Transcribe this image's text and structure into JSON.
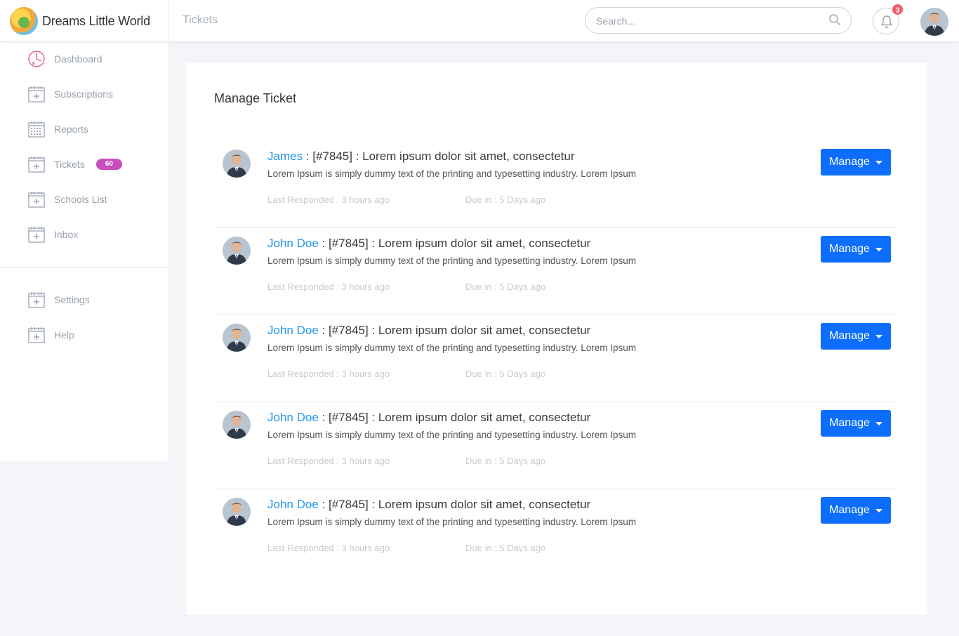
{
  "app": {
    "brand_name": "Dreams Little World"
  },
  "header": {
    "breadcrumb": "Tickets",
    "search_placeholder": "Search...",
    "notification_count": "3"
  },
  "sidebar": {
    "items": [
      {
        "label": "Dashboard",
        "icon": "dashboard-icon"
      },
      {
        "label": "Subscriptions",
        "icon": "calendar-plus-icon"
      },
      {
        "label": "Reports",
        "icon": "calendar-grid-icon"
      },
      {
        "label": "Tickets",
        "icon": "calendar-plus-icon",
        "badge": "60"
      },
      {
        "label": "Schools List",
        "icon": "calendar-plus-icon"
      },
      {
        "label": "Inbox",
        "icon": "calendar-plus-icon"
      }
    ],
    "bottom_items": [
      {
        "label": "Settings",
        "icon": "calendar-plus-icon"
      },
      {
        "label": "Help",
        "icon": "calendar-plus-icon"
      }
    ]
  },
  "main": {
    "title": "Manage Ticket",
    "tickets": [
      {
        "name": "James",
        "separator": " : ",
        "subject": "[#7845] : Lorem ipsum dolor sit amet, consectetur",
        "description": "Lorem Ipsum is simply dummy text of the printing and typesetting industry. Lorem Ipsum",
        "last_responded": "Last Responded : 3 hours ago",
        "due": "Due in : 5 Days ago",
        "button": "Manage"
      },
      {
        "name": "John Doe",
        "separator": " : ",
        "subject": "[#7845] : Lorem ipsum dolor sit amet, consectetur",
        "description": "Lorem Ipsum is simply dummy text of the printing and typesetting industry. Lorem Ipsum",
        "last_responded": "Last Responded : 3 hours ago",
        "due": "Due in : 5 Days ago",
        "button": "Manage"
      },
      {
        "name": "John Doe",
        "separator": " : ",
        "subject": "[#7845] : Lorem ipsum dolor sit amet, consectetur",
        "description": "Lorem Ipsum is simply dummy text of the printing and typesetting industry. Lorem Ipsum",
        "last_responded": "Last Responded : 3 hours ago",
        "due": "Due in : 5 Days ago",
        "button": "Manage"
      },
      {
        "name": "John Doe",
        "separator": " : ",
        "subject": "[#7845] : Lorem ipsum dolor sit amet, consectetur",
        "description": "Lorem Ipsum is simply dummy text of the printing and typesetting industry. Lorem Ipsum",
        "last_responded": "Last Responded : 3 hours ago",
        "due": "Due in : 5 Days ago",
        "button": "Manage"
      },
      {
        "name": "John Doe",
        "separator": " : ",
        "subject": "[#7845] : Lorem ipsum dolor sit amet, consectetur",
        "description": "Lorem Ipsum is simply dummy text of the printing and typesetting industry. Lorem Ipsum",
        "last_responded": "Last Responded : 3 hours ago",
        "due": "Due in : 5 Days ago",
        "button": "Manage"
      }
    ]
  },
  "colors": {
    "accent": "#0d6efd",
    "link": "#2196f3",
    "badge": "#c84fbd",
    "notification": "#f55a6b"
  }
}
